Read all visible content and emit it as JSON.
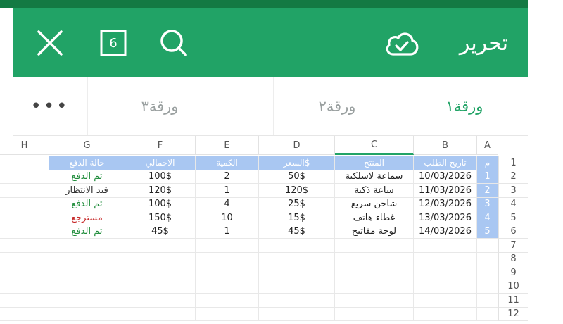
{
  "toolbar": {
    "title": "تحرير",
    "sheet_count": "6",
    "icons": [
      "close-icon",
      "sheets-count-icon",
      "search-icon",
      "cloud-check-icon"
    ],
    "color": "#21a366"
  },
  "tabs": {
    "items": [
      {
        "label": "ورقة١",
        "active": true
      },
      {
        "label": "ورقة٢",
        "active": false
      },
      {
        "label": "ورقة٣",
        "active": false
      }
    ],
    "more_label": "•••"
  },
  "grid": {
    "columns": [
      "A",
      "B",
      "C",
      "D",
      "E",
      "F",
      "G",
      "H"
    ],
    "rows": [
      "1",
      "2",
      "3",
      "4",
      "5",
      "6",
      "7",
      "8",
      "9",
      "10",
      "11",
      "12"
    ],
    "headers": {
      "num": "م",
      "date": "تاريخ الطلب",
      "product": "المنتج",
      "price": "السعر$",
      "qty": "الكمية",
      "total": "الاجمالي",
      "status": "حالة الدفع"
    },
    "records": [
      {
        "num": "1",
        "date": "10/03/2026",
        "product": "سماعة لاسلكية",
        "price": "50$",
        "qty": "2",
        "total": "100$",
        "status": "تم الدفع",
        "status_type": "paid"
      },
      {
        "num": "2",
        "date": "11/03/2026",
        "product": "ساعة ذكية",
        "price": "120$",
        "qty": "1",
        "total": "120$",
        "status": "قيد الانتظار",
        "status_type": "pending"
      },
      {
        "num": "3",
        "date": "12/03/2026",
        "product": "شاحن سريع",
        "price": "25$",
        "qty": "4",
        "total": "100$",
        "status": "تم الدفع",
        "status_type": "paid"
      },
      {
        "num": "4",
        "date": "13/03/2026",
        "product": "غطاء هاتف",
        "price": "15$",
        "qty": "10",
        "total": "150$",
        "status": "مسترجع",
        "status_type": "refund"
      },
      {
        "num": "5",
        "date": "14/03/2026",
        "product": "لوحة مفاتيح",
        "price": "45$",
        "qty": "1",
        "total": "45$",
        "status": "تم الدفع",
        "status_type": "paid"
      }
    ],
    "colors": {
      "header_fill": "#a9c7f2",
      "paid": "#1e8c3a",
      "refund": "#c62828"
    }
  }
}
